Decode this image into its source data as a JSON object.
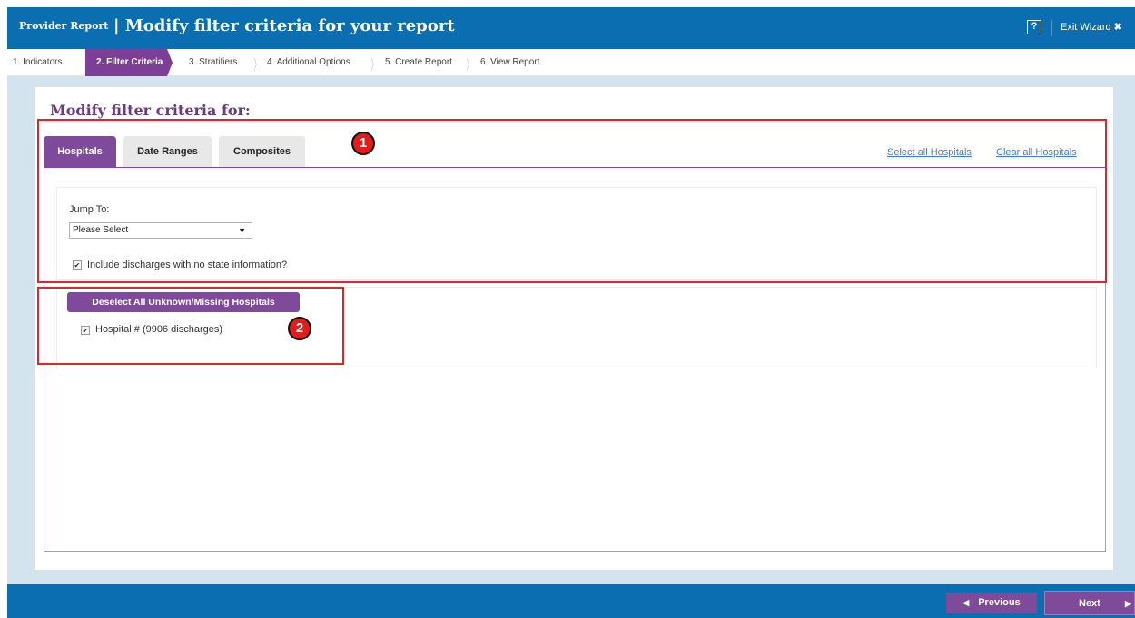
{
  "header": {
    "subtitle": "Provider Report",
    "separator": "|",
    "title": "Modify filter criteria for your report",
    "help_label": "?",
    "exit_label": "Exit Wizard",
    "exit_glyph": "✖"
  },
  "steps": [
    {
      "label": "1. Indicators",
      "active": false
    },
    {
      "label": "2. Filter Criteria",
      "active": true
    },
    {
      "label": "3. Stratifiers",
      "active": false
    },
    {
      "label": "4. Additional Options",
      "active": false
    },
    {
      "label": "5. Create Report",
      "active": false
    },
    {
      "label": "6. View Report",
      "active": false
    }
  ],
  "main": {
    "title": "Modify filter criteria for:",
    "tabs": [
      {
        "label": "Hospitals",
        "active": true
      },
      {
        "label": "Date Ranges",
        "active": false
      },
      {
        "label": "Composites",
        "active": false
      }
    ],
    "select_all_link": "Select all Hospitals",
    "clear_all_link": "Clear all Hospitals",
    "jump_to_label": "Jump To:",
    "jump_to_value": "Please Select",
    "include_discharges_label": "Include discharges with no state information?",
    "include_discharges_checked": true,
    "deselect_button": "Deselect All Unknown/Missing Hospitals",
    "hospitals": [
      {
        "label": "Hospital # (9906 discharges)",
        "checked": true
      }
    ]
  },
  "annotations": [
    {
      "label": "1"
    },
    {
      "label": "2"
    }
  ],
  "footer": {
    "previous_label": "Previous",
    "next_label": "Next"
  },
  "colors": {
    "header_blue": "#0a6eb0",
    "accent_purple": "#7e4a99",
    "annotation_red": "#e41b1b",
    "link_blue": "#3d7fd3"
  }
}
